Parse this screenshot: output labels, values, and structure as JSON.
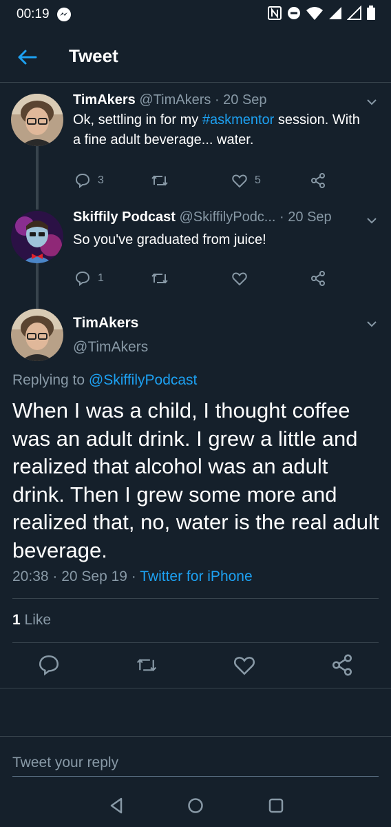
{
  "status_bar": {
    "time": "00:19"
  },
  "header": {
    "title": "Tweet"
  },
  "thread": [
    {
      "name": "TimAkers",
      "handle": "@TimAkers",
      "time": "· 20 Sep",
      "text_before": "Ok, settling in for my ",
      "hashtag": "#askmentor",
      "text_after": " session. With a fine adult beverage... water.",
      "reply_count": "3",
      "like_count": "5"
    },
    {
      "name": "Skiffily Podcast",
      "handle": "@SkiffilyPodc...",
      "time": "· 20 Sep",
      "text": "So you've graduated from juice!",
      "reply_count": "1",
      "like_count": ""
    }
  ],
  "main_tweet": {
    "name": "TimAkers",
    "handle": "@TimAkers",
    "replying_prefix": "Replying to ",
    "replying_to": "@SkiffilyPodcast",
    "text": "When I was a child, I thought coffee was an adult drink. I grew a little and realized that alcohol was an adult drink. Then I grew some more and realized that, no, water is the real adult beverage.",
    "timestamp": "20:38 · 20 Sep 19 · ",
    "source": "Twitter for iPhone",
    "like_count": "1",
    "like_label": "Like"
  },
  "reply_box": {
    "placeholder": "Tweet your reply"
  },
  "colors": {
    "background": "#15202b",
    "accent": "#1da1f2",
    "muted": "#8899a6",
    "divider": "#38444d"
  },
  "icons": [
    "back-arrow-icon",
    "reply-icon",
    "retweet-icon",
    "like-icon",
    "share-icon",
    "chevron-down-icon",
    "nav-back-icon",
    "nav-home-icon",
    "nav-recents-icon"
  ]
}
